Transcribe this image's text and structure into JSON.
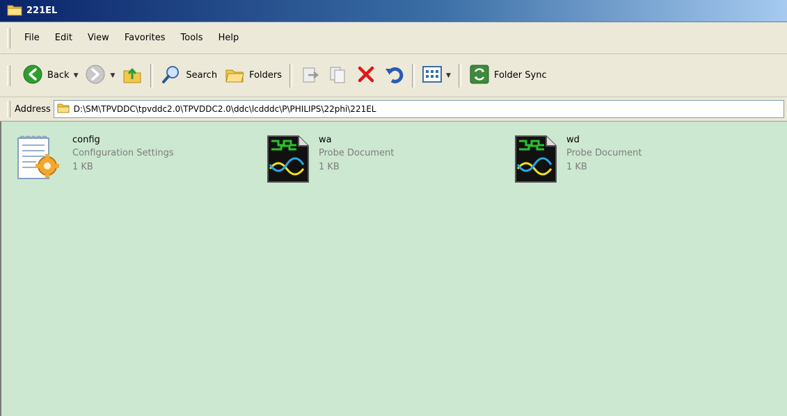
{
  "window": {
    "title": "221EL"
  },
  "menu": {
    "items": [
      "File",
      "Edit",
      "View",
      "Favorites",
      "Tools",
      "Help"
    ]
  },
  "toolbar": {
    "back_label": "Back",
    "search_label": "Search",
    "folders_label": "Folders",
    "folder_sync_label": "Folder Sync"
  },
  "address": {
    "label": "Address",
    "path": "D:\\SM\\TPVDDC\\tpvddc2.0\\TPVDDC2.0\\ddc\\lcdddc\\P\\PHILIPS\\22phi\\221EL"
  },
  "files": [
    {
      "name": "config",
      "type": "Configuration Settings",
      "size": "1 KB",
      "icon": "config-settings-icon"
    },
    {
      "name": "wa",
      "type": "Probe Document",
      "size": "1 KB",
      "icon": "probe-document-icon"
    },
    {
      "name": "wd",
      "type": "Probe Document",
      "size": "1 KB",
      "icon": "probe-document-icon"
    }
  ]
}
